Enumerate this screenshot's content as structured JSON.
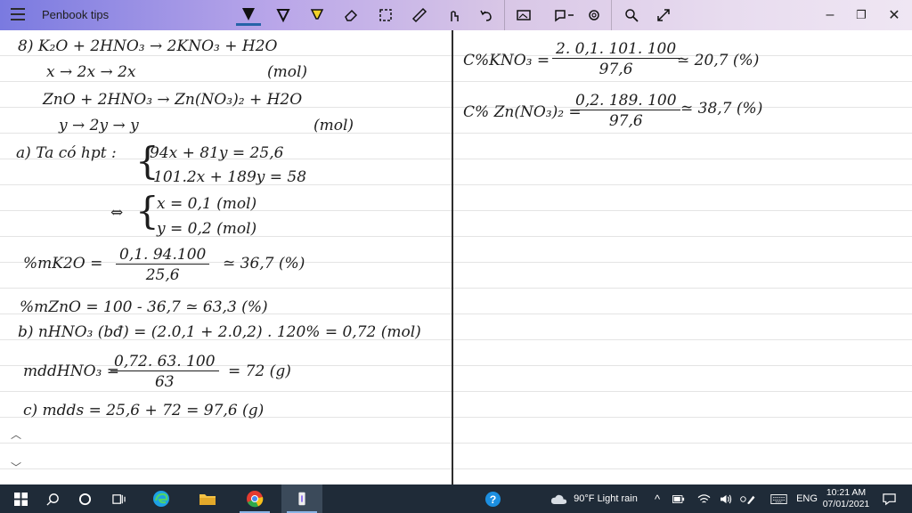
{
  "app": {
    "title": "Penbook tips"
  },
  "toolbar": {
    "tools": [
      "ballpoint-pen",
      "pencil",
      "highlighter",
      "eraser",
      "lasso-select",
      "ruler",
      "touch-writing",
      "undo"
    ],
    "extras": [
      "add-image",
      "shapes",
      "settings",
      "search",
      "expand"
    ]
  },
  "notes": {
    "left": {
      "l1": "8) K₂O + 2HNO₃ → 2KNO₃ + H2O",
      "l2a": "x → 2x → 2x",
      "l2b": "(mol)",
      "l3": "ZnO + 2HNO₃ → Zn(NO₃)₂ + H2O",
      "l4a": "y → 2y → y",
      "l4b": "(mol)",
      "l5a": "a) Ta có hpt :",
      "l5b": "94x + 81y = 25,6",
      "l6": "101.2x + 189y = 58",
      "l7a": "⇔",
      "l7b": "x = 0,1 (mol)",
      "l8": "y = 0,2 (mol)",
      "l9a": "%mK2O =",
      "l9num": "0,1. 94.100",
      "l9den": "25,6",
      "l9b": "≃ 36,7 (%)",
      "l10": "%mZnO = 100 - 36,7 ≃ 63,3 (%)",
      "l11": "b) nHNO₃ (bđ) = (2.0,1 + 2.0,2) . 120% = 0,72 (mol)",
      "l12a": "mddHNO₃ =",
      "l12num": "0,72. 63. 100",
      "l12den": "63",
      "l12b": "= 72 (g)",
      "l13": "c) mdds = 25,6 + 72 = 97,6 (g)"
    },
    "right": {
      "r1a": "C%KNO₃ =",
      "r1num": "2. 0,1. 101. 100",
      "r1den": "97,6",
      "r1b": "≃ 20,7 (%)",
      "r2a": "C% Zn(NO₃)₂ =",
      "r2num": "0,2. 189. 100",
      "r2den": "97,6",
      "r2b": "≃ 38,7 (%)"
    }
  },
  "taskbar": {
    "weather": "90°F  Light rain",
    "lang": "ENG",
    "time": "10:21 AM",
    "date": "07/01/2021"
  }
}
